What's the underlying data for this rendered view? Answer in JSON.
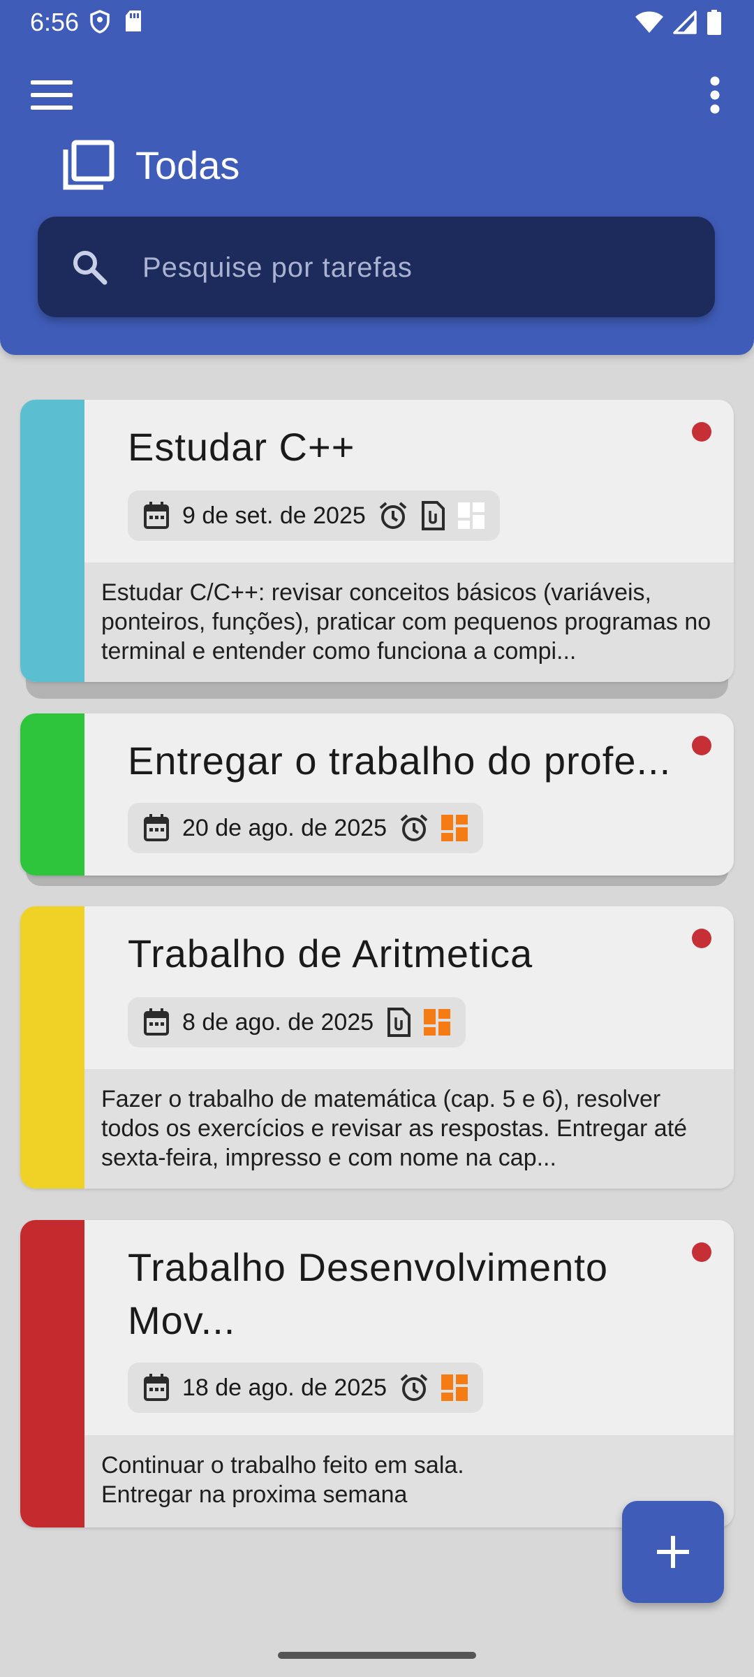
{
  "status_bar": {
    "time": "6:56",
    "left_icons": [
      "shield-icon",
      "sd-card-icon"
    ],
    "right_icons": [
      "wifi-icon",
      "signal-icon",
      "battery-icon"
    ]
  },
  "header": {
    "title": "Todas",
    "menu_icon": "hamburger-menu-icon",
    "more_icon": "more-vert-icon",
    "title_icon": "stack-icon"
  },
  "search": {
    "placeholder": "Pesquise por tarefas",
    "value": ""
  },
  "colors": {
    "primary": "#3f5cb8",
    "search_bg": "#1d2a5c",
    "priority_dot": "#c62f35",
    "tag_orange": "#f57c14"
  },
  "tasks": [
    {
      "title": "Estudar C++",
      "date": "9 de set. de 2025",
      "color": "#5bbfd1",
      "has_alarm": true,
      "has_attachment": true,
      "subtasks_active": false,
      "description": "Estudar C/C++: revisar conceitos básicos (variáveis, ponteiros, funções), praticar com pequenos programas no terminal e entender como funciona a compi..."
    },
    {
      "title": "Entregar o trabalho do profe...",
      "date": "20 de ago. de 2025",
      "color": "#2ec43b",
      "has_alarm": true,
      "has_attachment": false,
      "subtasks_active": true,
      "description": ""
    },
    {
      "title": "Trabalho de Aritmetica",
      "date": "8 de ago. de 2025",
      "color": "#f0d125",
      "has_alarm": false,
      "has_attachment": true,
      "subtasks_active": true,
      "description": "Fazer o trabalho de matemática (cap. 5 e 6), resolver todos os exercícios e revisar as respostas. Entregar até sexta-feira, impresso e com nome na cap..."
    },
    {
      "title_line1": "Trabalho Desenvolvimento",
      "title_line2": "Mov...",
      "date": "18 de ago. de 2025",
      "color": "#c42b2e",
      "has_alarm": true,
      "has_attachment": false,
      "subtasks_active": true,
      "description_line1": "Continuar o trabalho feito em sala.",
      "description_line2": "Entregar na proxima semana"
    }
  ],
  "fab": {
    "icon": "plus-icon"
  }
}
